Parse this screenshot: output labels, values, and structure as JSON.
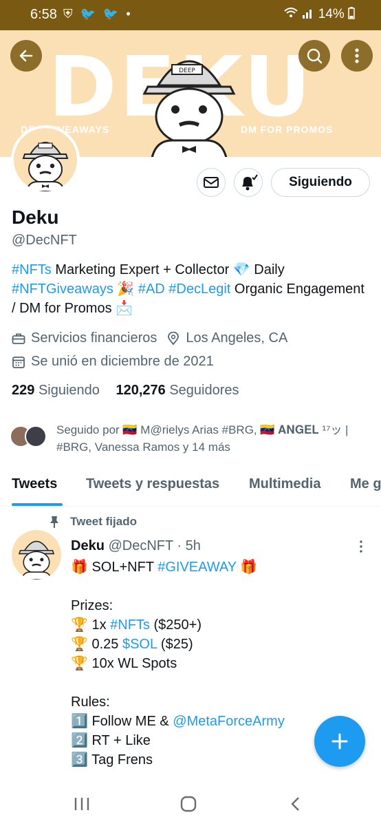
{
  "status_bar": {
    "time": "6:58",
    "left_icons": "⛨ 🐦 🐦 •",
    "battery": "14%"
  },
  "banner": {
    "word": "DEKU",
    "left_text": "DEC GIVEAWAYS",
    "right_text": "DM FOR PROMOS",
    "cap_text": "DEEP"
  },
  "profile": {
    "name": "Deku",
    "handle": "@DecNFT",
    "follow_label": "Siguiendo",
    "bio": {
      "tag_nfts": "#NFTs",
      "text1": " Marketing Expert + Collector 💎   Daily",
      "tag_giveaways": "#NFTGiveaways",
      "party": " 🎉 ",
      "tag_ad": "#AD",
      "tag_legit": "#DecLegit",
      "text2": "  Organic Engagement / DM for Promos 📩"
    },
    "category": "Servicios financieros",
    "location": "Los Angeles, CA",
    "joined": "Se unió en diciembre de 2021",
    "following_count": "229",
    "following_label": "Siguiendo",
    "followers_count": "120,276",
    "followers_label": "Seguidores",
    "followed_by": "Seguido por 🇻🇪 M@rielys Arias #BRG, 🇻🇪 𝐀𝐍𝐆𝐄𝐋 ¹⁷ッ | #BRG, Vanessa Ramos y 14 más"
  },
  "tabs": [
    "Tweets",
    "Tweets y respuestas",
    "Multimedia",
    "Me gusta"
  ],
  "tweet": {
    "pinned_label": "Tweet fijado",
    "author": "Deku",
    "handle_time": "@DecNFT · 5h",
    "line1_a": "🎁 SOL+NFT ",
    "line1_tag": "#GIVEAWAY",
    "line1_b": " 🎁",
    "prizes_label": "Prizes:",
    "prize1_a": "🏆 1x ",
    "prize1_tag": "#NFTs",
    "prize1_b": " ($250+)",
    "prize2_a": "🏆 0.25 ",
    "prize2_tag": "$SOL",
    "prize2_b": " ($25)",
    "prize3": "🏆 10x WL Spots",
    "rules_label": "Rules:",
    "rule1_a": "1️⃣ Follow ME & ",
    "rule1_tag": "@MetaForceArmy",
    "rule2": "2️⃣ RT + Like",
    "rule3": "3️⃣ Tag Frens"
  },
  "colors": {
    "accent": "#1d9bf0",
    "banner": "#fce0b5",
    "status_bar": "#7a5a12"
  }
}
